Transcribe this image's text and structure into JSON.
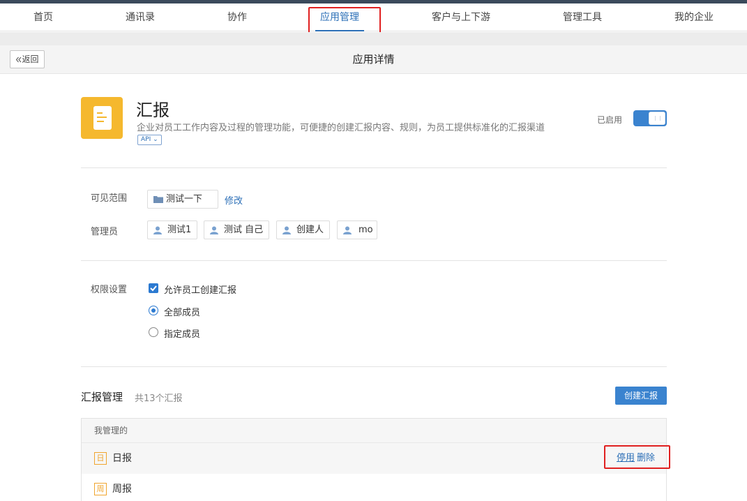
{
  "nav": {
    "items": [
      {
        "label": "首页"
      },
      {
        "label": "通讯录"
      },
      {
        "label": "协作"
      },
      {
        "label": "应用管理"
      },
      {
        "label": "客户与上下游"
      },
      {
        "label": "管理工具"
      },
      {
        "label": "我的企业"
      }
    ],
    "active_index": 3
  },
  "subheader": {
    "back_label": "返回",
    "back_icon": "double-chevron-left-icon",
    "title": "应用详情"
  },
  "app": {
    "name": "汇报",
    "description": "企业对员工工作内容及过程的管理功能，可便捷的创建汇报内容、规则，为员工提供标准化的汇报渠道",
    "api_tag": "API",
    "status_label": "已启用",
    "enabled": true,
    "icon": "document-icon",
    "icon_color": "#f5b82e"
  },
  "visibility": {
    "label": "可见范围",
    "scope": "测试一下",
    "scope_icon": "folder-icon",
    "edit_label": "修改"
  },
  "admins": {
    "label": "管理员",
    "icon": "user-icon",
    "items": [
      {
        "name": "测试1"
      },
      {
        "name": "测试 自己"
      },
      {
        "name": "创建人"
      },
      {
        "name": "mo"
      }
    ]
  },
  "permissions": {
    "label": "权限设置",
    "allow_create_label": "允许员工创建汇报",
    "allow_create_checked": true,
    "options": [
      {
        "label": "全部成员",
        "selected": true
      },
      {
        "label": "指定成员",
        "selected": false
      }
    ]
  },
  "reports": {
    "title": "汇报管理",
    "count_text": "共13个汇报",
    "create_label": "创建汇报",
    "group_label": "我管理的",
    "items": [
      {
        "badge": "日",
        "name": "日报",
        "disable_label": "停用",
        "delete_label": "删除"
      },
      {
        "badge": "周",
        "name": "周报"
      }
    ]
  },
  "colors": {
    "accent": "#2c6fb7",
    "primary_button": "#3a83cf",
    "report_badge": "#f0a52e",
    "highlight_box": "#e02020"
  }
}
